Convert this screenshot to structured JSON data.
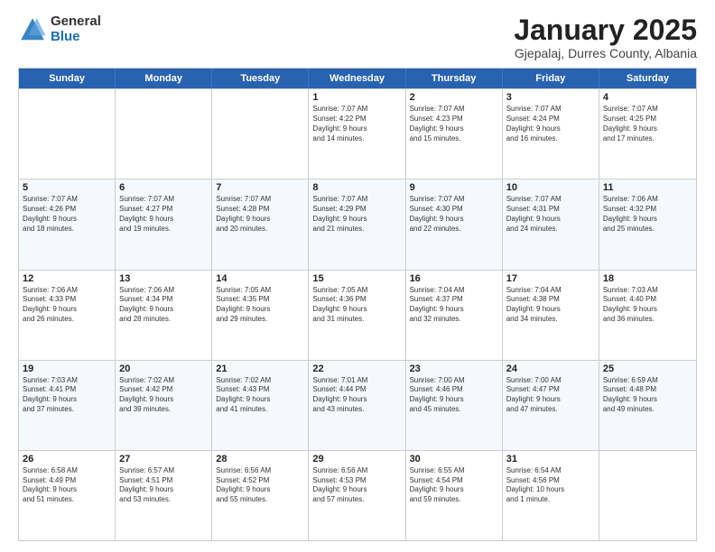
{
  "logo": {
    "general": "General",
    "blue": "Blue"
  },
  "title": "January 2025",
  "subtitle": "Gjepalaj, Durres County, Albania",
  "headers": [
    "Sunday",
    "Monday",
    "Tuesday",
    "Wednesday",
    "Thursday",
    "Friday",
    "Saturday"
  ],
  "rows": [
    [
      {
        "day": "",
        "info": ""
      },
      {
        "day": "",
        "info": ""
      },
      {
        "day": "",
        "info": ""
      },
      {
        "day": "1",
        "info": "Sunrise: 7:07 AM\nSunset: 4:22 PM\nDaylight: 9 hours\nand 14 minutes."
      },
      {
        "day": "2",
        "info": "Sunrise: 7:07 AM\nSunset: 4:23 PM\nDaylight: 9 hours\nand 15 minutes."
      },
      {
        "day": "3",
        "info": "Sunrise: 7:07 AM\nSunset: 4:24 PM\nDaylight: 9 hours\nand 16 minutes."
      },
      {
        "day": "4",
        "info": "Sunrise: 7:07 AM\nSunset: 4:25 PM\nDaylight: 9 hours\nand 17 minutes."
      }
    ],
    [
      {
        "day": "5",
        "info": "Sunrise: 7:07 AM\nSunset: 4:26 PM\nDaylight: 9 hours\nand 18 minutes."
      },
      {
        "day": "6",
        "info": "Sunrise: 7:07 AM\nSunset: 4:27 PM\nDaylight: 9 hours\nand 19 minutes."
      },
      {
        "day": "7",
        "info": "Sunrise: 7:07 AM\nSunset: 4:28 PM\nDaylight: 9 hours\nand 20 minutes."
      },
      {
        "day": "8",
        "info": "Sunrise: 7:07 AM\nSunset: 4:29 PM\nDaylight: 9 hours\nand 21 minutes."
      },
      {
        "day": "9",
        "info": "Sunrise: 7:07 AM\nSunset: 4:30 PM\nDaylight: 9 hours\nand 22 minutes."
      },
      {
        "day": "10",
        "info": "Sunrise: 7:07 AM\nSunset: 4:31 PM\nDaylight: 9 hours\nand 24 minutes."
      },
      {
        "day": "11",
        "info": "Sunrise: 7:06 AM\nSunset: 4:32 PM\nDaylight: 9 hours\nand 25 minutes."
      }
    ],
    [
      {
        "day": "12",
        "info": "Sunrise: 7:06 AM\nSunset: 4:33 PM\nDaylight: 9 hours\nand 26 minutes."
      },
      {
        "day": "13",
        "info": "Sunrise: 7:06 AM\nSunset: 4:34 PM\nDaylight: 9 hours\nand 28 minutes."
      },
      {
        "day": "14",
        "info": "Sunrise: 7:05 AM\nSunset: 4:35 PM\nDaylight: 9 hours\nand 29 minutes."
      },
      {
        "day": "15",
        "info": "Sunrise: 7:05 AM\nSunset: 4:36 PM\nDaylight: 9 hours\nand 31 minutes."
      },
      {
        "day": "16",
        "info": "Sunrise: 7:04 AM\nSunset: 4:37 PM\nDaylight: 9 hours\nand 32 minutes."
      },
      {
        "day": "17",
        "info": "Sunrise: 7:04 AM\nSunset: 4:38 PM\nDaylight: 9 hours\nand 34 minutes."
      },
      {
        "day": "18",
        "info": "Sunrise: 7:03 AM\nSunset: 4:40 PM\nDaylight: 9 hours\nand 36 minutes."
      }
    ],
    [
      {
        "day": "19",
        "info": "Sunrise: 7:03 AM\nSunset: 4:41 PM\nDaylight: 9 hours\nand 37 minutes."
      },
      {
        "day": "20",
        "info": "Sunrise: 7:02 AM\nSunset: 4:42 PM\nDaylight: 9 hours\nand 39 minutes."
      },
      {
        "day": "21",
        "info": "Sunrise: 7:02 AM\nSunset: 4:43 PM\nDaylight: 9 hours\nand 41 minutes."
      },
      {
        "day": "22",
        "info": "Sunrise: 7:01 AM\nSunset: 4:44 PM\nDaylight: 9 hours\nand 43 minutes."
      },
      {
        "day": "23",
        "info": "Sunrise: 7:00 AM\nSunset: 4:46 PM\nDaylight: 9 hours\nand 45 minutes."
      },
      {
        "day": "24",
        "info": "Sunrise: 7:00 AM\nSunset: 4:47 PM\nDaylight: 9 hours\nand 47 minutes."
      },
      {
        "day": "25",
        "info": "Sunrise: 6:59 AM\nSunset: 4:48 PM\nDaylight: 9 hours\nand 49 minutes."
      }
    ],
    [
      {
        "day": "26",
        "info": "Sunrise: 6:58 AM\nSunset: 4:49 PM\nDaylight: 9 hours\nand 51 minutes."
      },
      {
        "day": "27",
        "info": "Sunrise: 6:57 AM\nSunset: 4:51 PM\nDaylight: 9 hours\nand 53 minutes."
      },
      {
        "day": "28",
        "info": "Sunrise: 6:56 AM\nSunset: 4:52 PM\nDaylight: 9 hours\nand 55 minutes."
      },
      {
        "day": "29",
        "info": "Sunrise: 6:56 AM\nSunset: 4:53 PM\nDaylight: 9 hours\nand 57 minutes."
      },
      {
        "day": "30",
        "info": "Sunrise: 6:55 AM\nSunset: 4:54 PM\nDaylight: 9 hours\nand 59 minutes."
      },
      {
        "day": "31",
        "info": "Sunrise: 6:54 AM\nSunset: 4:56 PM\nDaylight: 10 hours\nand 1 minute."
      },
      {
        "day": "",
        "info": ""
      }
    ]
  ],
  "alt_rows": [
    false,
    true,
    false,
    true,
    false
  ]
}
